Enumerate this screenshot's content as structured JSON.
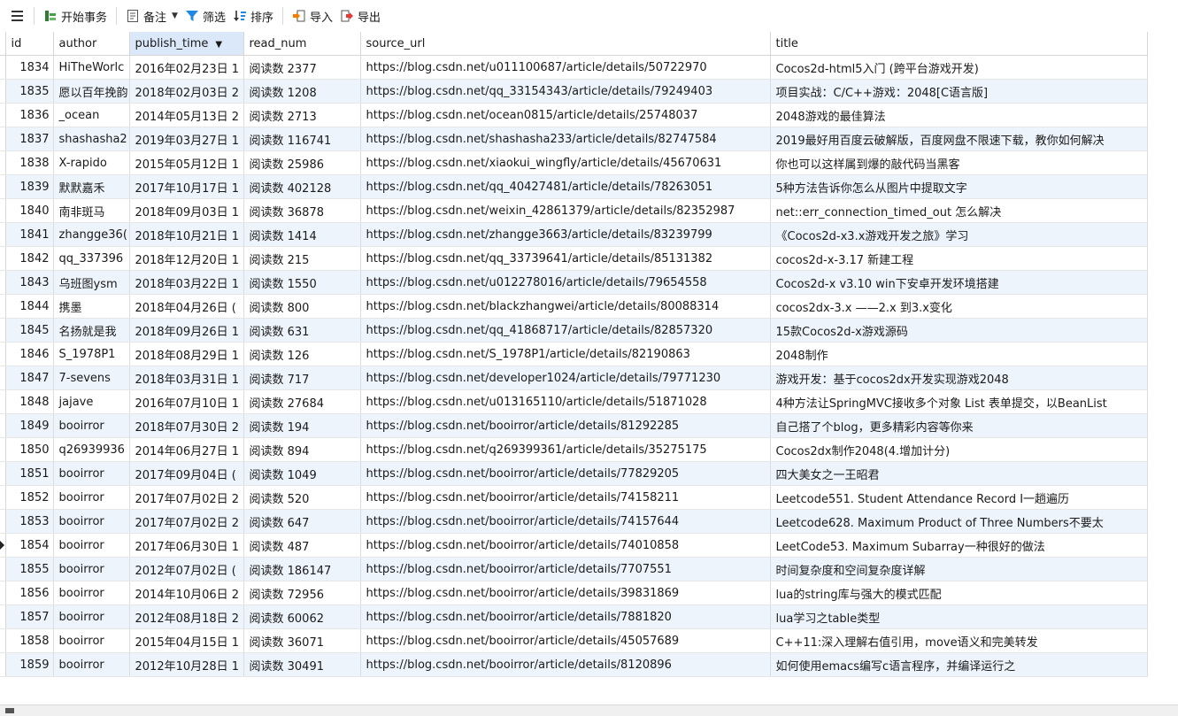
{
  "toolbar": {
    "menu_icon": "hamburger-icon",
    "begin_label": "开始事务",
    "note_label": "备注",
    "filter_label": "筛选",
    "sort_label": "排序",
    "import_label": "导入",
    "export_label": "导出"
  },
  "columns": [
    "id",
    "author",
    "publish_time",
    "read_num",
    "source_url",
    "title"
  ],
  "sorted_column": "publish_time",
  "current_row_id": "1854",
  "rows": [
    [
      "1834",
      "HiTheWorlc",
      "2016年02月23日 1",
      "阅读数 2377",
      "https://blog.csdn.net/u011100687/article/details/50722970",
      "Cocos2d-html5入门 (跨平台游戏开发)"
    ],
    [
      "1835",
      "愿以百年挽韵",
      "2018年02月03日 2",
      "阅读数 1208",
      "https://blog.csdn.net/qq_33154343/article/details/79249403",
      "项目实战：C/C++游戏：2048[C语言版]"
    ],
    [
      "1836",
      "_ocean",
      "2014年05月13日 2",
      "阅读数 2713",
      "https://blog.csdn.net/ocean0815/article/details/25748037",
      "2048游戏的最佳算法"
    ],
    [
      "1837",
      "shashasha2",
      "2019年03月27日 1",
      "阅读数 116741",
      "https://blog.csdn.net/shashasha233/article/details/82747584",
      "2019最好用百度云破解版，百度网盘不限速下载，教你如何解决"
    ],
    [
      "1838",
      "X-rapido",
      "2015年05月12日 1",
      "阅读数 25986",
      "https://blog.csdn.net/xiaokui_wingfly/article/details/45670631",
      "你也可以这样属到爆的敲代码当黑客"
    ],
    [
      "1839",
      "默默嘉禾",
      "2017年10月17日 1",
      "阅读数 402128",
      "https://blog.csdn.net/qq_40427481/article/details/78263051",
      "5种方法告诉你怎么从图片中提取文字"
    ],
    [
      "1840",
      "南非斑马",
      "2018年09月03日 1",
      "阅读数 36878",
      "https://blog.csdn.net/weixin_42861379/article/details/82352987",
      "net::err_connection_timed_out 怎么解决"
    ],
    [
      "1841",
      "zhangge36(",
      "2018年10月21日 1",
      "阅读数 1414",
      "https://blog.csdn.net/zhangge3663/article/details/83239799",
      "《Cocos2d-x3.x游戏开发之旅》学习"
    ],
    [
      "1842",
      "qq_337396",
      "2018年12月20日 1",
      "阅读数 215",
      "https://blog.csdn.net/qq_33739641/article/details/85131382",
      "cocos2d-x-3.17 新建工程"
    ],
    [
      "1843",
      "乌班图ysm",
      "2018年03月22日 1",
      "阅读数 1550",
      "https://blog.csdn.net/u012278016/article/details/79654558",
      "Cocos2d-x v3.10 win下安卓开发环境搭建"
    ],
    [
      "1844",
      "携墨",
      "2018年04月26日 (",
      "阅读数 800",
      "https://blog.csdn.net/blackzhangwei/article/details/80088314",
      "cocos2dx-3.x ——2.x 到3.x变化"
    ],
    [
      "1845",
      "名扬就是我",
      "2018年09月26日 1",
      "阅读数 631",
      "https://blog.csdn.net/qq_41868717/article/details/82857320",
      "15款Cocos2d-x游戏源码"
    ],
    [
      "1846",
      "S_1978P1",
      "2018年08月29日 1",
      "阅读数 126",
      "https://blog.csdn.net/S_1978P1/article/details/82190863",
      "2048制作"
    ],
    [
      "1847",
      "7-sevens",
      "2018年03月31日 1",
      "阅读数 717",
      "https://blog.csdn.net/developer1024/article/details/79771230",
      "游戏开发：基于cocos2dx开发实现游戏2048"
    ],
    [
      "1848",
      "jajave",
      "2016年07月10日 1",
      "阅读数 27684",
      "https://blog.csdn.net/u013165110/article/details/51871028",
      "4种方法让SpringMVC接收多个对象 List 表单提交，以BeanList"
    ],
    [
      "1849",
      "booirror",
      "2018年07月30日 2",
      "阅读数 194",
      "https://blog.csdn.net/booirror/article/details/81292285",
      "自己搭了个blog，更多精彩内容等你来"
    ],
    [
      "1850",
      "q26939936",
      "2014年06月27日 1",
      "阅读数 894",
      "https://blog.csdn.net/q269399361/article/details/35275175",
      "Cocos2dx制作2048(4.增加计分)"
    ],
    [
      "1851",
      "booirror",
      "2017年09月04日 (",
      "阅读数 1049",
      "https://blog.csdn.net/booirror/article/details/77829205",
      "四大美女之一王昭君"
    ],
    [
      "1852",
      "booirror",
      "2017年07月02日 2",
      "阅读数 520",
      "https://blog.csdn.net/booirror/article/details/74158211",
      "Leetcode551. Student Attendance Record I一趟遍历"
    ],
    [
      "1853",
      "booirror",
      "2017年07月02日 2",
      "阅读数 647",
      "https://blog.csdn.net/booirror/article/details/74157644",
      "Leetcode628. Maximum Product of Three Numbers不要太"
    ],
    [
      "1854",
      "booirror",
      "2017年06月30日 1",
      "阅读数 487",
      "https://blog.csdn.net/booirror/article/details/74010858",
      "LeetCode53. Maximum Subarray一种很好的做法"
    ],
    [
      "1855",
      "booirror",
      "2012年07月02日 (",
      "阅读数 186147",
      "https://blog.csdn.net/booirror/article/details/7707551",
      "时间复杂度和空间复杂度详解"
    ],
    [
      "1856",
      "booirror",
      "2014年10月06日 2",
      "阅读数 72956",
      "https://blog.csdn.net/booirror/article/details/39831869",
      "lua的string库与强大的模式匹配"
    ],
    [
      "1857",
      "booirror",
      "2012年08月18日 2",
      "阅读数 60062",
      "https://blog.csdn.net/booirror/article/details/7881820",
      "lua学习之table类型"
    ],
    [
      "1858",
      "booirror",
      "2015年04月15日 1",
      "阅读数 36071",
      "https://blog.csdn.net/booirror/article/details/45057689",
      "C++11:深入理解右值引用，move语义和完美转发"
    ],
    [
      "1859",
      "booirror",
      "2012年10月28日 1",
      "阅读数 30491",
      "https://blog.csdn.net/booirror/article/details/8120896",
      "如何使用emacs编写c语言程序，并编译运行之"
    ]
  ],
  "colors": {
    "alt_row": "#eef4fc",
    "sorted_header": "#dbe8f9",
    "grid_line": "#dcdcdc"
  }
}
